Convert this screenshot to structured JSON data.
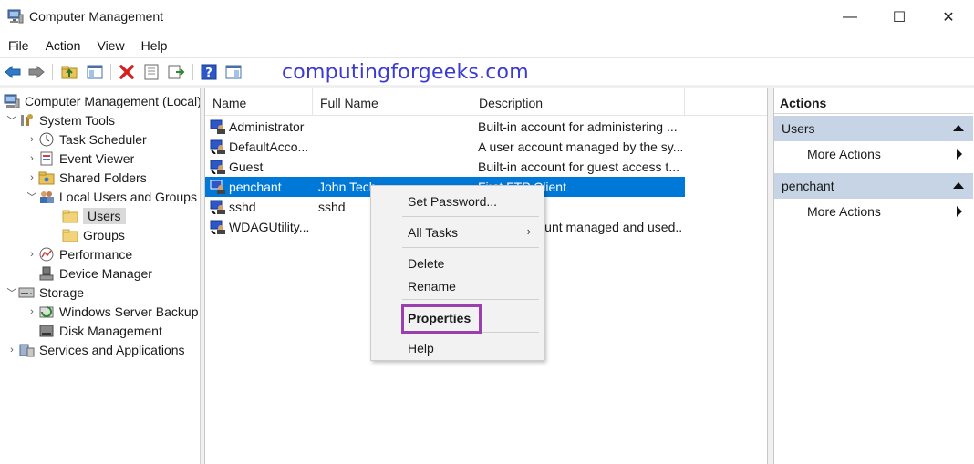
{
  "window": {
    "title": "Computer Management",
    "controls": {
      "minimize": "—",
      "maximize": "☐",
      "close": "✕"
    }
  },
  "menu": [
    "File",
    "Action",
    "View",
    "Help"
  ],
  "watermark": "computingforgeeks.com",
  "tree": [
    {
      "label": "Computer Management (Local)",
      "icon": "computer-management-icon"
    },
    {
      "label": "System Tools",
      "icon": "system-tools-icon"
    },
    {
      "label": "Task Scheduler",
      "icon": "clock-icon"
    },
    {
      "label": "Event Viewer",
      "icon": "event-viewer-icon"
    },
    {
      "label": "Shared Folders",
      "icon": "shared-folder-icon"
    },
    {
      "label": "Local Users and Groups",
      "icon": "users-groups-icon"
    },
    {
      "label": "Users",
      "icon": "folder-icon"
    },
    {
      "label": "Groups",
      "icon": "folder-icon"
    },
    {
      "label": "Performance",
      "icon": "performance-icon"
    },
    {
      "label": "Device Manager",
      "icon": "device-manager-icon"
    },
    {
      "label": "Storage",
      "icon": "storage-icon"
    },
    {
      "label": "Windows Server Backup",
      "icon": "backup-icon"
    },
    {
      "label": "Disk Management",
      "icon": "disk-icon"
    },
    {
      "label": "Services and Applications",
      "icon": "services-icon"
    }
  ],
  "list": {
    "columns": [
      "Name",
      "Full Name",
      "Description"
    ],
    "rows": [
      {
        "name": "Administrator",
        "full_name": "",
        "description": "Built-in account for administering ..."
      },
      {
        "name": "DefaultAcco...",
        "full_name": "",
        "description": "A user account managed by the sy..."
      },
      {
        "name": "Guest",
        "full_name": "",
        "description": "Built-in account for guest access t..."
      },
      {
        "name": "penchant",
        "full_name": "John Tech",
        "description": "First FTP Client"
      },
      {
        "name": "sshd",
        "full_name": "sshd",
        "description": ""
      },
      {
        "name": "WDAGUtility...",
        "full_name": "",
        "description": "A user account managed and used..."
      }
    ]
  },
  "context_menu": {
    "items": [
      "Set Password...",
      "All Tasks",
      "Delete",
      "Rename",
      "Properties",
      "Help"
    ],
    "submenu_glyph": "›"
  },
  "actions": {
    "title": "Actions",
    "sections": [
      {
        "label": "Users",
        "item": "More Actions"
      },
      {
        "label": "penchant",
        "item": "More Actions"
      }
    ]
  },
  "colors": {
    "selection": "#0078d7",
    "actions_header": "#c7d4e6",
    "highlight_box": "#9b3fae",
    "watermark": "#3b3bd4"
  }
}
